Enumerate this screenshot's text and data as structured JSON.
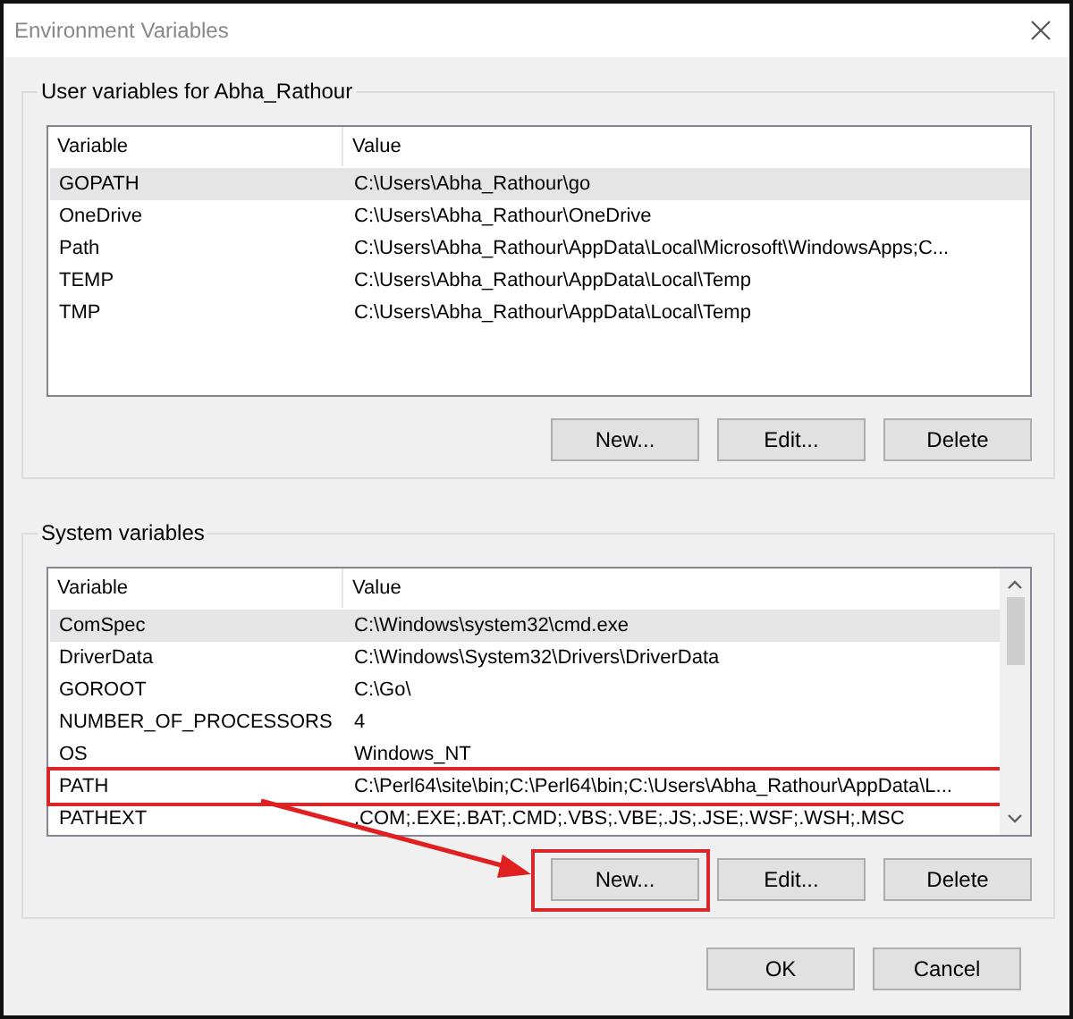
{
  "window": {
    "title": "Environment Variables"
  },
  "user_variables": {
    "title": "User variables for Abha_Rathour",
    "columns": [
      "Variable",
      "Value"
    ],
    "scrollbar": false,
    "rows": [
      {
        "variable": "GOPATH",
        "value": "C:\\Users\\Abha_Rathour\\go",
        "selected": true,
        "highlighted": false
      },
      {
        "variable": "OneDrive",
        "value": "C:\\Users\\Abha_Rathour\\OneDrive",
        "selected": false,
        "highlighted": false
      },
      {
        "variable": "Path",
        "value": "C:\\Users\\Abha_Rathour\\AppData\\Local\\Microsoft\\WindowsApps;C...",
        "selected": false,
        "highlighted": false
      },
      {
        "variable": "TEMP",
        "value": "C:\\Users\\Abha_Rathour\\AppData\\Local\\Temp",
        "selected": false,
        "highlighted": false
      },
      {
        "variable": "TMP",
        "value": "C:\\Users\\Abha_Rathour\\AppData\\Local\\Temp",
        "selected": false,
        "highlighted": false
      }
    ],
    "buttons": [
      {
        "label": "New...",
        "highlighted": false
      },
      {
        "label": "Edit...",
        "highlighted": false
      },
      {
        "label": "Delete",
        "highlighted": false
      }
    ]
  },
  "system_variables": {
    "title": "System variables",
    "columns": [
      "Variable",
      "Value"
    ],
    "scrollbar": true,
    "rows": [
      {
        "variable": "ComSpec",
        "value": "C:\\Windows\\system32\\cmd.exe",
        "selected": true,
        "highlighted": false
      },
      {
        "variable": "DriverData",
        "value": "C:\\Windows\\System32\\Drivers\\DriverData",
        "selected": false,
        "highlighted": false
      },
      {
        "variable": "GOROOT",
        "value": "C:\\Go\\",
        "selected": false,
        "highlighted": false
      },
      {
        "variable": "NUMBER_OF_PROCESSORS",
        "value": "4",
        "selected": false,
        "highlighted": false
      },
      {
        "variable": "OS",
        "value": "Windows_NT",
        "selected": false,
        "highlighted": false
      },
      {
        "variable": "PATH",
        "value": "C:\\Perl64\\site\\bin;C:\\Perl64\\bin;C:\\Users\\Abha_Rathour\\AppData\\L...",
        "selected": false,
        "highlighted": true
      },
      {
        "variable": "PATHEXT",
        "value": ".COM;.EXE;.BAT;.CMD;.VBS;.VBE;.JS;.JSE;.WSF;.WSH;.MSC",
        "selected": false,
        "highlighted": false
      }
    ],
    "buttons": [
      {
        "label": "New...",
        "highlighted": true
      },
      {
        "label": "Edit...",
        "highlighted": false
      },
      {
        "label": "Delete",
        "highlighted": false
      }
    ]
  },
  "footer_buttons": [
    "OK",
    "Cancel"
  ]
}
